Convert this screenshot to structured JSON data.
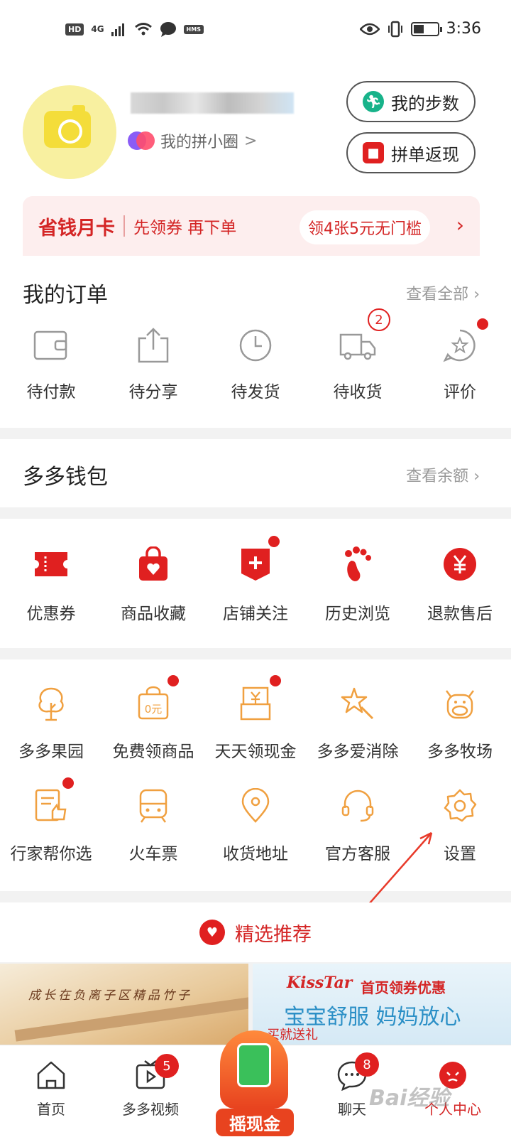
{
  "status_bar": {
    "hd": "HD",
    "network": "4G",
    "hms": "HMS",
    "time": "3:36"
  },
  "profile": {
    "circle_label": "我的拼小圈",
    "steps_button": "我的步数",
    "cashback_button": "拼单返现"
  },
  "saving_card": {
    "title": "省钱月卡",
    "subtitle": "先领券 再下单",
    "pill": "领4张5元无门槛"
  },
  "orders": {
    "title": "我的订单",
    "view_all": "查看全部",
    "items": [
      {
        "label": "待付款",
        "icon": "wallet-icon"
      },
      {
        "label": "待分享",
        "icon": "share-icon"
      },
      {
        "label": "待发货",
        "icon": "clock-icon"
      },
      {
        "label": "待收货",
        "icon": "truck-icon",
        "badge": "2"
      },
      {
        "label": "评价",
        "icon": "review-icon",
        "dot": true
      }
    ]
  },
  "wallet": {
    "title": "多多钱包",
    "view_balance": "查看余额"
  },
  "shortcuts": {
    "items": [
      {
        "label": "优惠券",
        "icon": "coupon-icon"
      },
      {
        "label": "商品收藏",
        "icon": "favorite-bag-icon"
      },
      {
        "label": "店铺关注",
        "icon": "store-follow-icon",
        "dot": true
      },
      {
        "label": "历史浏览",
        "icon": "footprint-icon"
      },
      {
        "label": "退款售后",
        "icon": "refund-icon"
      }
    ]
  },
  "services": {
    "row1": [
      {
        "label": "多多果园",
        "icon": "tree-icon"
      },
      {
        "label": "免费领商品",
        "icon": "free-goods-icon",
        "badge_text": "0元",
        "dot": true
      },
      {
        "label": "天天领现金",
        "icon": "cash-icon",
        "dot": true
      },
      {
        "label": "多多爱消除",
        "icon": "star-wand-icon"
      },
      {
        "label": "多多牧场",
        "icon": "cow-icon"
      }
    ],
    "row2": [
      {
        "label": "行家帮你选",
        "icon": "recommend-doc-icon",
        "dot": true
      },
      {
        "label": "火车票",
        "icon": "train-icon"
      },
      {
        "label": "收货地址",
        "icon": "location-icon"
      },
      {
        "label": "官方客服",
        "icon": "headset-icon"
      },
      {
        "label": "设置",
        "icon": "gear-icon"
      }
    ]
  },
  "recommend": {
    "title": "精选推荐"
  },
  "products": {
    "a_text": "成长在负离子区精品竹子",
    "b_brand": "KissTar",
    "b_promo": "首页领券优惠",
    "b_slogan": "宝宝舒服 妈妈放心",
    "b_gift": "买就送礼"
  },
  "tabbar": {
    "home": "首页",
    "video": "多多视频",
    "video_badge": "5",
    "center": "摇现金",
    "chat": "聊天",
    "chat_badge": "8",
    "me": "个人中心"
  },
  "watermark": "Bai经验",
  "colors": {
    "accent": "#e02020",
    "orange_icon": "#f0a040",
    "text_gray": "#999999"
  }
}
